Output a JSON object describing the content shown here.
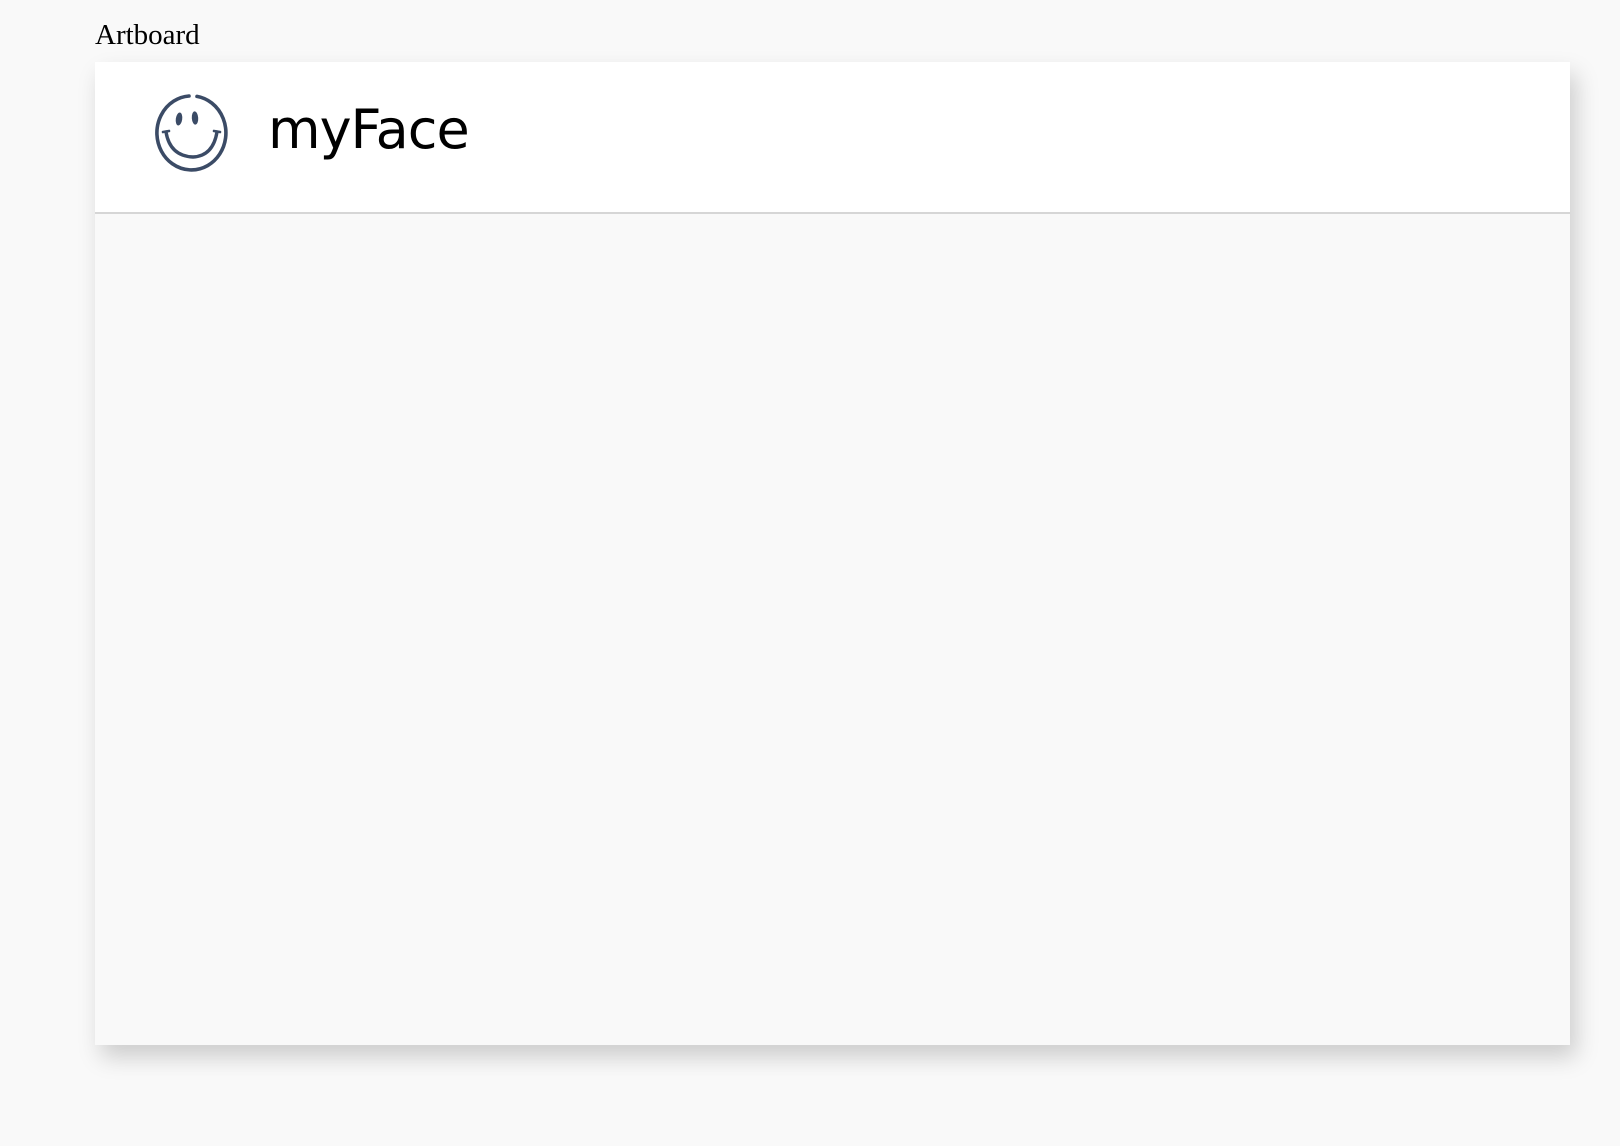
{
  "artboard": {
    "label": "Artboard"
  },
  "header": {
    "brand_name": "myFace",
    "logo_icon": "smiley-face-icon",
    "logo_color": "#3b4b66"
  },
  "colors": {
    "page_background": "#f9f9f9",
    "header_background": "#ffffff",
    "divider": "#d6d6d6"
  }
}
